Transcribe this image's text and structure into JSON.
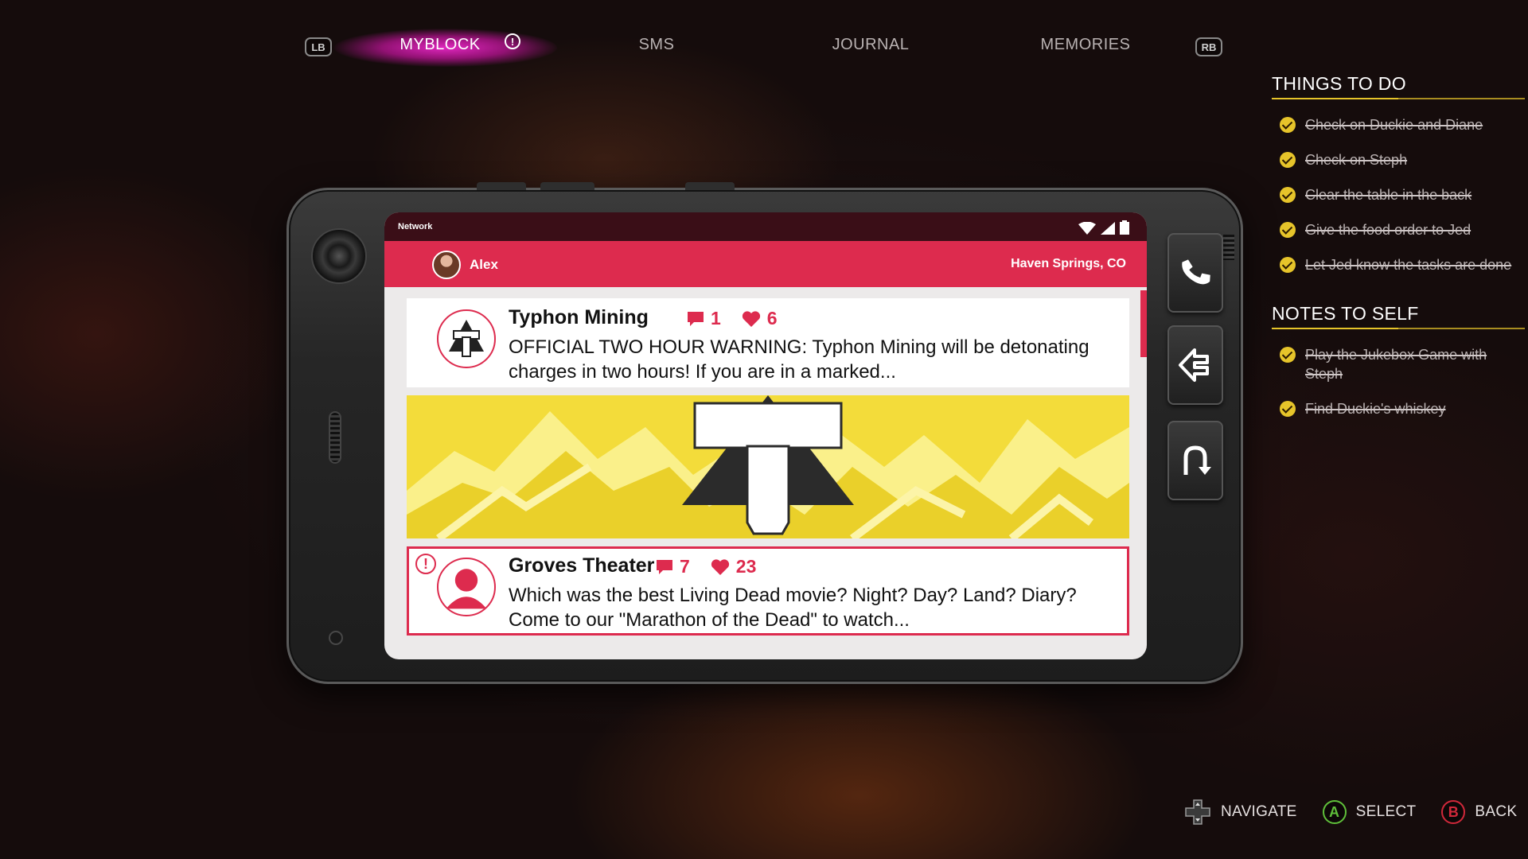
{
  "topnav": {
    "lb_label": "LB",
    "rb_label": "RB",
    "tabs": [
      {
        "label": "MYBLOCK",
        "active": true,
        "alert": true
      },
      {
        "label": "SMS"
      },
      {
        "label": "JOURNAL"
      },
      {
        "label": "MEMORIES"
      }
    ],
    "alert_glyph": "!"
  },
  "phone": {
    "status": {
      "network_label": "Network",
      "icons": [
        "wifi-icon",
        "signal-icon",
        "battery-icon"
      ]
    },
    "header": {
      "user_name": "Alex",
      "location": "Haven Springs, CO"
    },
    "posts": [
      {
        "author": "Typhon Mining",
        "comments": "1",
        "likes": "6",
        "text": "OFFICIAL TWO HOUR WARNING: Typhon Mining will be detonating charges in two hours! If you are in a marked...",
        "has_banner": true,
        "highlighted": false
      },
      {
        "author": "Groves Theater",
        "comments": "7",
        "likes": "23",
        "text": "Which was the best Living Dead movie? Night? Day? Land? Diary? Come to our \"Marathon of the Dead\" to watch...",
        "has_banner": false,
        "highlighted": true,
        "alert_glyph": "!"
      }
    ],
    "side_buttons": [
      "phone-call-icon",
      "app-icon",
      "back-arrow-icon"
    ]
  },
  "things_to_do": {
    "title": "THINGS TO DO",
    "items": [
      {
        "text": "Check on Duckie and Diane",
        "done": true
      },
      {
        "text": "Check on Steph",
        "done": true
      },
      {
        "text": "Clear the table in the back",
        "done": true
      },
      {
        "text": "Give the food order to Jed",
        "done": true
      },
      {
        "text": "Let Jed know the tasks are done",
        "done": true
      }
    ]
  },
  "notes_to_self": {
    "title": "NOTES TO SELF",
    "items": [
      {
        "text": "Play the Jukebox Game with Steph",
        "done": true
      },
      {
        "text": "Find Duckie's whiskey",
        "done": true
      }
    ]
  },
  "footer": {
    "navigate": "NAVIGATE",
    "select_key": "A",
    "select": "SELECT",
    "back_key": "B",
    "back": "BACK"
  },
  "colors": {
    "accent": "#dd2b4e",
    "tab_glow": "#e428c4",
    "check": "#e6c42a",
    "banner_yellow": "#f3dc3a",
    "a_button": "#5fbf3a",
    "b_button": "#d0283a"
  }
}
